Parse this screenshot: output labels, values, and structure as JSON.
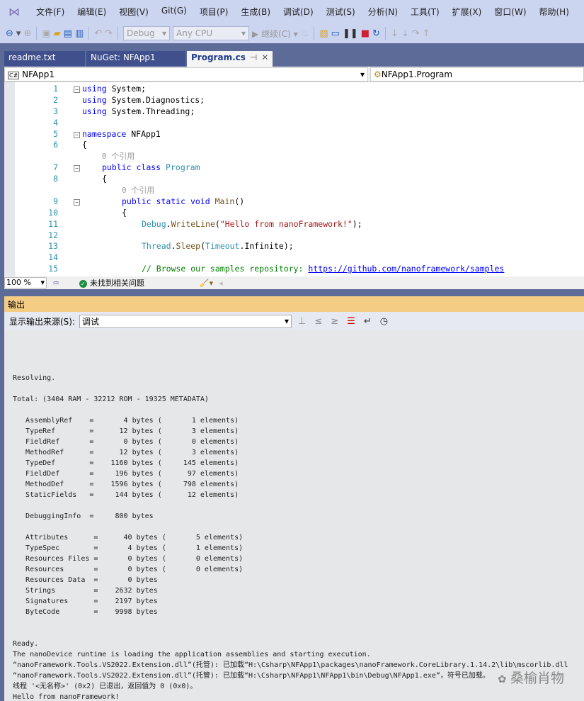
{
  "menu": [
    "文件(F)",
    "编辑(E)",
    "视图(V)",
    "Git(G)",
    "项目(P)",
    "生成(B)",
    "调试(D)",
    "测试(S)",
    "分析(N)",
    "工具(T)",
    "扩展(X)",
    "窗口(W)",
    "帮助(H)"
  ],
  "toolbar": {
    "config": "Debug",
    "platform": "Any CPU",
    "continue": "继续(C)"
  },
  "tabs": [
    {
      "label": "readme.txt"
    },
    {
      "label": "NuGet: NFApp1"
    },
    {
      "label": "Program.cs",
      "active": true
    }
  ],
  "nav": {
    "project": "NFApp1",
    "type": "NFApp1.Program"
  },
  "code": [
    {
      "n": "1",
      "fold": "−",
      "ind": 0,
      "t": [
        [
          "kw",
          "using"
        ],
        [
          "",
          "System;"
        ]
      ]
    },
    {
      "n": "2",
      "ind": 0,
      "t": [
        [
          "kw",
          "using"
        ],
        [
          "",
          "System.Diagnostics;"
        ]
      ]
    },
    {
      "n": "3",
      "ind": 0,
      "t": [
        [
          "kw",
          "using"
        ],
        [
          "",
          "System.Threading;"
        ]
      ]
    },
    {
      "n": "4",
      "ind": 0,
      "t": []
    },
    {
      "n": "5",
      "fold": "−",
      "ind": 0,
      "t": [
        [
          "kw",
          "namespace"
        ],
        [
          "",
          "NFApp1"
        ]
      ]
    },
    {
      "n": "6",
      "ind": 0,
      "t": [
        [
          "",
          "{"
        ]
      ]
    },
    {
      "n": "",
      "ind": 4,
      "t": [
        [
          "lens",
          "0 个引用"
        ]
      ]
    },
    {
      "n": "7",
      "fold": "−",
      "ind": 4,
      "t": [
        [
          "kw",
          "public"
        ],
        [
          "kw",
          "class"
        ],
        [
          "ty",
          "Program"
        ]
      ]
    },
    {
      "n": "8",
      "ind": 4,
      "t": [
        [
          "",
          "{"
        ]
      ]
    },
    {
      "n": "",
      "ind": 8,
      "t": [
        [
          "lens",
          "0 个引用"
        ]
      ]
    },
    {
      "n": "9",
      "fold": "−",
      "ind": 8,
      "t": [
        [
          "kw",
          "public"
        ],
        [
          "kw",
          "static"
        ],
        [
          "kw",
          "void"
        ],
        [
          "me",
          "Main"
        ],
        [
          "",
          "()"
        ]
      ]
    },
    {
      "n": "10",
      "ind": 8,
      "t": [
        [
          "",
          "{"
        ]
      ]
    },
    {
      "n": "11",
      "ind": 12,
      "t": [
        [
          "ty",
          "Debug"
        ],
        [
          "",
          "."
        ],
        [
          "me",
          "WriteLine"
        ],
        [
          "",
          "("
        ],
        [
          "st",
          "\"Hello from nanoFramework!\""
        ],
        [
          "",
          ");"
        ]
      ]
    },
    {
      "n": "12",
      "ind": 12,
      "t": []
    },
    {
      "n": "13",
      "ind": 12,
      "t": [
        [
          "ty",
          "Thread"
        ],
        [
          "",
          "."
        ],
        [
          "me",
          "Sleep"
        ],
        [
          "",
          "("
        ],
        [
          "ty",
          "Timeout"
        ],
        [
          "",
          ".Infinite);"
        ]
      ]
    },
    {
      "n": "14",
      "ind": 12,
      "t": []
    },
    {
      "n": "15",
      "ind": 12,
      "t": [
        [
          "cm",
          "// Browse our samples repository: "
        ],
        [
          "lk",
          "https://github.com/nanoframework/samples"
        ]
      ]
    }
  ],
  "status": {
    "zoom": "100 %",
    "issues": "未找到相关问题"
  },
  "output": {
    "title": "输出",
    "source_label": "显示输出来源(S):",
    "source": "调试",
    "lines": [
      "",
      "",
      "Resolving.",
      "",
      "Total: (3404 RAM - 32212 ROM - 19325 METADATA)",
      "",
      "   AssemblyRef    =       4 bytes (       1 elements)",
      "   TypeRef        =      12 bytes (       3 elements)",
      "   FieldRef       =       0 bytes (       0 elements)",
      "   MethodRef      =      12 bytes (       3 elements)",
      "   TypeDef        =    1160 bytes (     145 elements)",
      "   FieldDef       =     196 bytes (      97 elements)",
      "   MethodDef      =    1596 bytes (     798 elements)",
      "   StaticFields   =     144 bytes (      12 elements)",
      "",
      "   DebuggingInfo  =     800 bytes",
      "",
      "   Attributes      =      40 bytes (       5 elements)",
      "   TypeSpec        =       4 bytes (       1 elements)",
      "   Resources Files =       0 bytes (       0 elements)",
      "   Resources       =       0 bytes (       0 elements)",
      "   Resources Data  =       0 bytes",
      "   Strings         =    2632 bytes",
      "   Signatures      =    2197 bytes",
      "   ByteCode        =    9998 bytes",
      "",
      "",
      "Ready.",
      "The nanoDevice runtime is loading the application assemblies and starting execution.",
      "“nanoFramework.Tools.VS2022.Extension.dll”(托管): 已加载“H:\\Csharp\\NFApp1\\packages\\nanoFramework.CoreLibrary.1.14.2\\lib\\mscorlib.dll",
      "“nanoFramework.Tools.VS2022.Extension.dll”(托管): 已加载“H:\\Csharp\\NFApp1\\NFApp1\\bin\\Debug\\NFApp1.exe”，符号已加载。",
      "线程 '<无名称>' (0x2) 已退出，返回值为 0 (0x0)。",
      "Hello from nanoFramework!"
    ]
  },
  "watermark": "桑榆肖物"
}
